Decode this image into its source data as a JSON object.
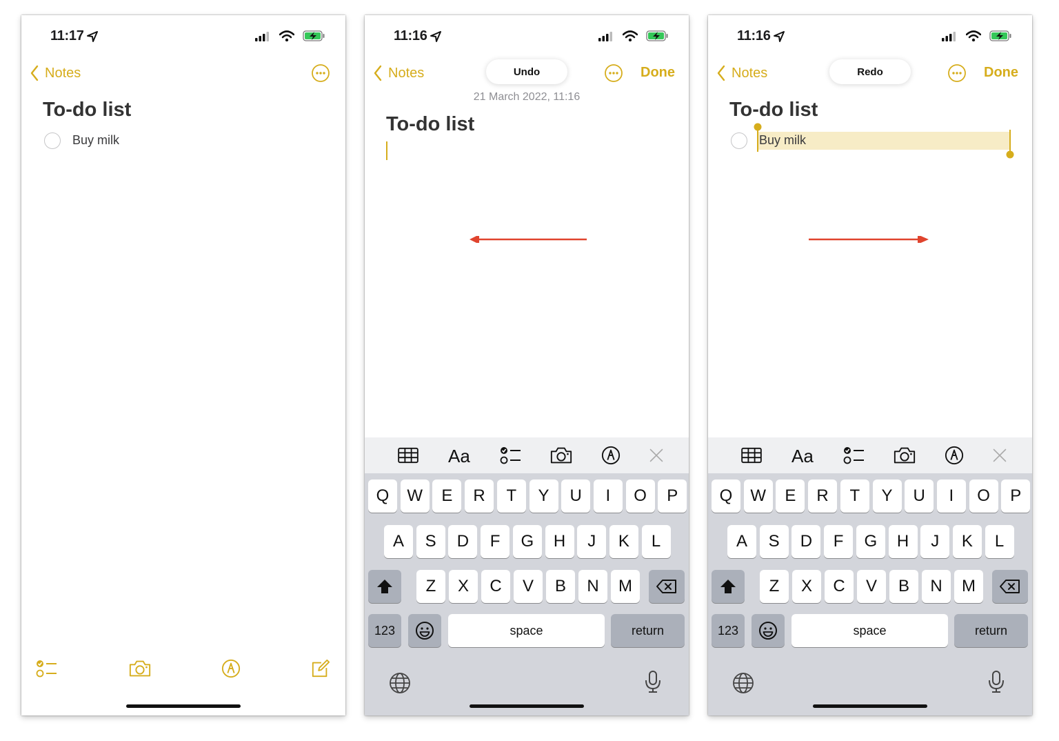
{
  "colors": {
    "accent": "#d6ad1c",
    "arrow": "#e0442e",
    "keyboard_bg": "#d3d5db"
  },
  "nav": {
    "back_label": "Notes",
    "done_label": "Done"
  },
  "note": {
    "title": "To-do list",
    "item": "Buy milk"
  },
  "screens": [
    {
      "time": "11:17"
    },
    {
      "time": "11:16",
      "pill": "Undo",
      "date": "21 March 2022, 11:16"
    },
    {
      "time": "11:16",
      "pill": "Redo"
    }
  ],
  "keyboard": {
    "row1": [
      "Q",
      "W",
      "E",
      "R",
      "T",
      "Y",
      "U",
      "I",
      "O",
      "P"
    ],
    "row2": [
      "A",
      "S",
      "D",
      "F",
      "G",
      "H",
      "J",
      "K",
      "L"
    ],
    "row3": [
      "Z",
      "X",
      "C",
      "V",
      "B",
      "N",
      "M"
    ],
    "numbers_label": "123",
    "space_label": "space",
    "return_label": "return"
  },
  "icons": {
    "status": [
      "location-arrow-icon",
      "cellular-signal-icon",
      "wifi-icon",
      "battery-charging-icon"
    ],
    "bottom_toolbar": [
      "checklist-icon",
      "camera-icon",
      "markup-icon",
      "compose-icon"
    ],
    "keyboard_toolbar": [
      "table-icon",
      "format-text-icon",
      "checklist-icon",
      "camera-icon",
      "markup-icon",
      "close-icon"
    ],
    "keyboard_bottom": [
      "globe-icon",
      "microphone-icon"
    ]
  }
}
